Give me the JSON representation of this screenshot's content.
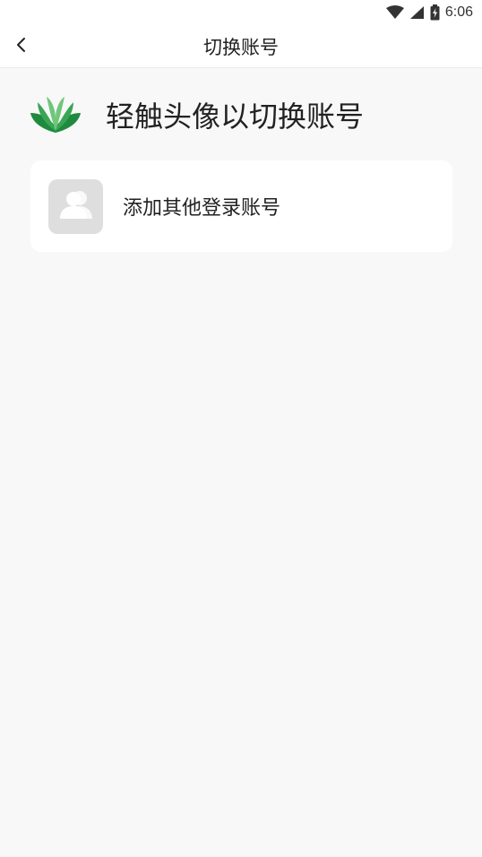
{
  "status_bar": {
    "time": "6:06",
    "icons": [
      "wifi-icon",
      "cell-signal-icon",
      "battery-charging-icon"
    ]
  },
  "app_bar": {
    "back_icon": "chevron-left-icon",
    "title": "切换账号"
  },
  "hint": {
    "logo_icon": "book-logo-icon",
    "text": "轻触头像以切换账号"
  },
  "add_account": {
    "avatar_icon": "user-group-placeholder-icon",
    "label": "添加其他登录账号"
  },
  "colors": {
    "background": "#f8f8f8",
    "surface": "#ffffff",
    "avatar_placeholder": "#dedede",
    "logo_dark_green": "#1f8a3f",
    "logo_light_green": "#6fc77a"
  }
}
